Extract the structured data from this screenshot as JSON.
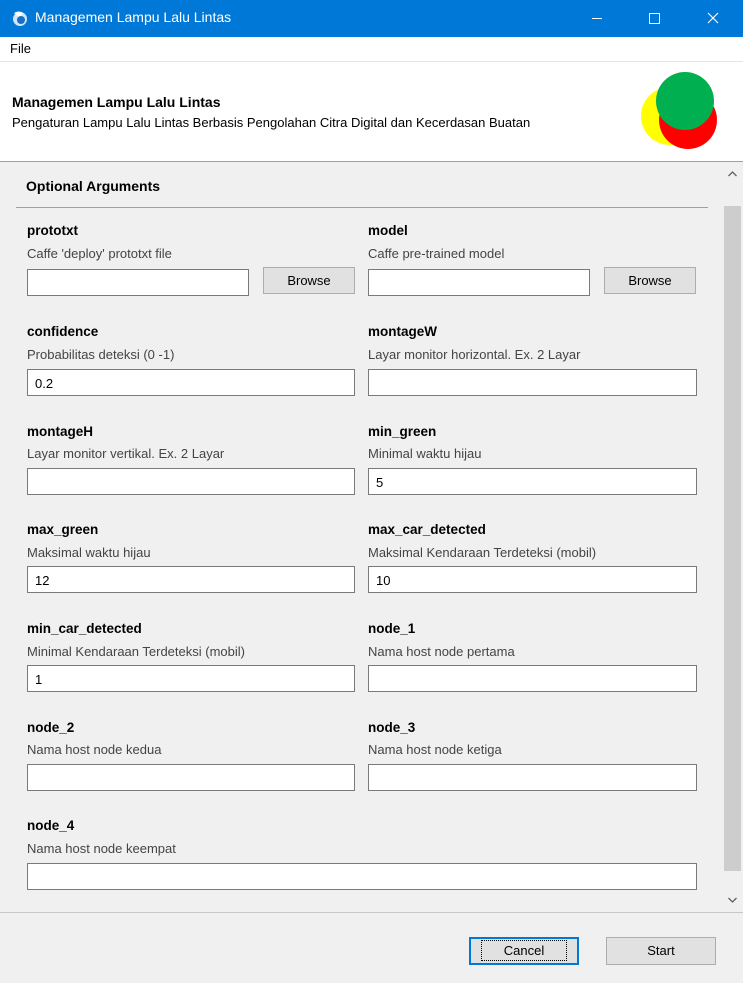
{
  "window": {
    "title": "Managemen Lampu Lalu Lintas",
    "controls": [
      "minimize-icon",
      "maximize-icon",
      "close-icon"
    ]
  },
  "menu": {
    "file": "File"
  },
  "header": {
    "title": "Managemen Lampu Lalu Lintas",
    "subtitle": "Pengaturan Lampu Lalu Lintas Berbasis Pengolahan Citra Digital dan Kecerdasan Buatan",
    "logo_colors": {
      "yellow": "#ffff00",
      "red": "#ff0000",
      "green": "#00b050"
    }
  },
  "group": {
    "title": "Optional Arguments"
  },
  "browse_label": "Browse",
  "fields": {
    "prototxt": {
      "label": "prototxt",
      "desc": "Caffe 'deploy' prototxt file",
      "value": ""
    },
    "model": {
      "label": "model",
      "desc": "Caffe pre-trained model",
      "value": ""
    },
    "confidence": {
      "label": "confidence",
      "desc": "Probabilitas deteksi (0 -1)",
      "value": "0.2"
    },
    "montageW": {
      "label": "montageW",
      "desc": "Layar monitor horizontal. Ex. 2 Layar",
      "value": ""
    },
    "montageH": {
      "label": "montageH",
      "desc": "Layar monitor vertikal. Ex. 2 Layar",
      "value": ""
    },
    "min_green": {
      "label": "min_green",
      "desc": "Minimal waktu hijau",
      "value": "5"
    },
    "max_green": {
      "label": "max_green",
      "desc": "Maksimal waktu hijau",
      "value": "12"
    },
    "max_car_detected": {
      "label": "max_car_detected",
      "desc": "Maksimal Kendaraan Terdeteksi (mobil)",
      "value": "10"
    },
    "min_car_detected": {
      "label": "min_car_detected",
      "desc": "Minimal Kendaraan Terdeteksi (mobil)",
      "value": "1"
    },
    "node_1": {
      "label": "node_1",
      "desc": "Nama host node pertama",
      "value": ""
    },
    "node_2": {
      "label": "node_2",
      "desc": "Nama host node kedua",
      "value": ""
    },
    "node_3": {
      "label": "node_3",
      "desc": "Nama host node ketiga",
      "value": ""
    },
    "node_4": {
      "label": "node_4",
      "desc": "Nama host node keempat",
      "value": ""
    }
  },
  "footer": {
    "cancel": "Cancel",
    "start": "Start"
  }
}
